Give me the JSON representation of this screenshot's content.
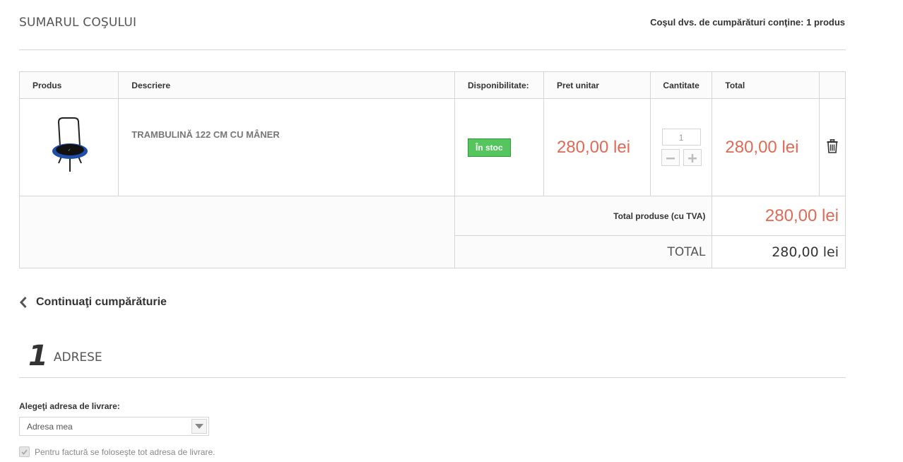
{
  "header": {
    "title": "SUMARUL COŞULUI",
    "cart_count_text": "Coşul dvs. de cumpărături conţine: 1 produs"
  },
  "table": {
    "columns": [
      "Produs",
      "Descriere",
      "Disponibilitate:",
      "Pret unitar",
      "Cantitate",
      "Total"
    ],
    "item": {
      "image_icon": "trampoline-image",
      "description": "TRAMBULINĂ 122 CM CU MÂNER",
      "availability": "În stoc",
      "unit_price": "280,00 lei",
      "quantity": "1",
      "total": "280,00 lei",
      "delete_icon": "trash-icon"
    },
    "summary": {
      "products_label": "Total produse (cu TVA)",
      "products_value": "280,00 lei",
      "total_label": "TOTAL",
      "total_value": "280,00 lei"
    }
  },
  "continue_shopping": "Continuaţi cumpărăturie",
  "step": {
    "number": "1",
    "title": "ADRESE"
  },
  "address": {
    "label": "Alegeţi adresa de livrare:",
    "selected": "Adresa mea",
    "invoice_checkbox_label": "Pentru factură se foloseşte tot adresa de livrare.",
    "invoice_checked": true
  },
  "colors": {
    "price": "#e16a56",
    "in_stock": "#55c65e",
    "border": "#d6d4d4"
  }
}
